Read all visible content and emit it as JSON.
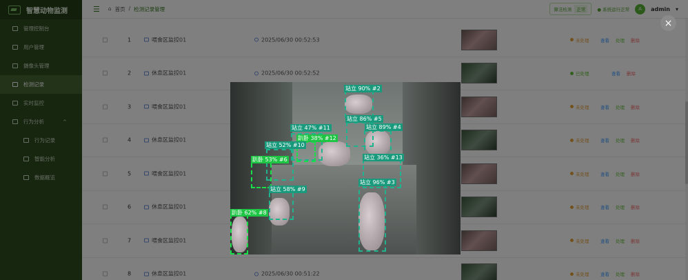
{
  "app": {
    "title": "智慧动物监测"
  },
  "sidebar": {
    "items": [
      {
        "label": "管理控制台",
        "icon": "monitor-icon"
      },
      {
        "label": "用户管理",
        "icon": "user-icon"
      },
      {
        "label": "摄像头管理",
        "icon": "camera-icon"
      },
      {
        "label": "检测记录",
        "icon": "record-icon",
        "active": true
      },
      {
        "label": "实时监控",
        "icon": "screen-icon"
      },
      {
        "label": "行为分析",
        "icon": "chart-icon",
        "expanded": true
      },
      {
        "label": "行为记录",
        "icon": "doc-icon",
        "sub": true
      },
      {
        "label": "智能分析",
        "icon": "ai-icon",
        "sub": true
      },
      {
        "label": "数据概览",
        "icon": "clock-icon",
        "sub": true
      }
    ]
  },
  "header": {
    "breadcrumb_home": "首页",
    "breadcrumb_sep": "/",
    "breadcrumb_current": "检测记录管理",
    "detect_label": "算法检测",
    "detect_value": "正常",
    "status": "系统运行正常",
    "avatar": "A",
    "user": "admin"
  },
  "table": {
    "rows": [
      {
        "idx": "1",
        "camera": "喂食区监控01",
        "time": "2025/06/30 00:52:53",
        "status": "未处理",
        "ok": false
      },
      {
        "idx": "2",
        "camera": "休息区监控01",
        "time": "2025/06/30 00:52:52",
        "status": "已处理",
        "ok": true
      },
      {
        "idx": "3",
        "camera": "喂食区监控01",
        "time": "",
        "status": "未处理",
        "ok": false
      },
      {
        "idx": "4",
        "camera": "休息区监控01",
        "time": "",
        "status": "未处理",
        "ok": false
      },
      {
        "idx": "5",
        "camera": "喂食区监控01",
        "time": "",
        "status": "未处理",
        "ok": false
      },
      {
        "idx": "6",
        "camera": "休息区监控01",
        "time": "",
        "status": "未处理",
        "ok": false
      },
      {
        "idx": "7",
        "camera": "喂食区监控01",
        "time": "",
        "status": "未处理",
        "ok": false
      },
      {
        "idx": "8",
        "camera": "休息区监控01",
        "time": "2025/06/30 00:51:22",
        "status": "未处理",
        "ok": false
      }
    ],
    "actions": {
      "view": "查看",
      "process": "处理",
      "delete": "删除"
    }
  },
  "viewer": {
    "close_icon": "×",
    "detections": [
      {
        "label": "站立 90% #2",
        "color": "t"
      },
      {
        "label": "站立 86% #5",
        "color": "t"
      },
      {
        "label": "站立 89% #4",
        "color": "t"
      },
      {
        "label": "站立 47% #11",
        "color": "t"
      },
      {
        "label": "趴卧 38% #12",
        "color": "g"
      },
      {
        "label": "站立 52% #10",
        "color": "t"
      },
      {
        "label": "站立 36% #13",
        "color": "t"
      },
      {
        "label": "趴卧 53% #6",
        "color": "g"
      },
      {
        "label": "站立 58% #9",
        "color": "t"
      },
      {
        "label": "站立 96% #3",
        "color": "t"
      },
      {
        "label": "趴卧 62% #8",
        "color": "g"
      }
    ]
  }
}
